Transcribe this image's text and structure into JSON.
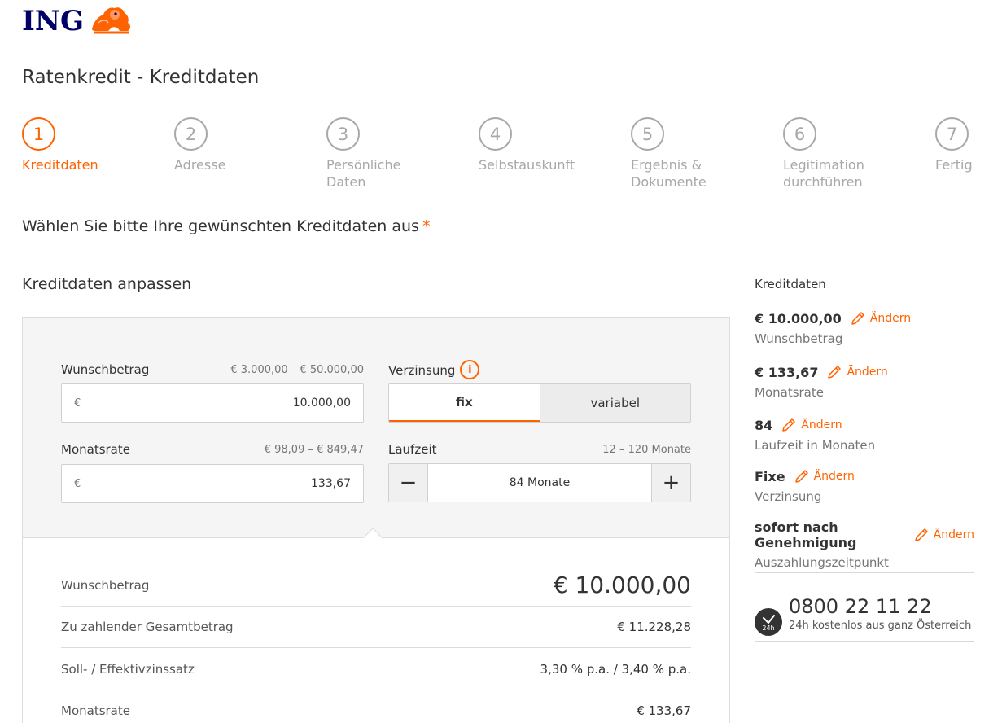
{
  "header": {
    "logo_text": "ING"
  },
  "page": {
    "title": "Ratenkredit - Kreditdaten"
  },
  "steps": [
    {
      "number": "1",
      "label": "Kreditdaten",
      "active": true
    },
    {
      "number": "2",
      "label": "Adresse",
      "active": false
    },
    {
      "number": "3",
      "label": "Persönliche\nDaten",
      "active": false
    },
    {
      "number": "4",
      "label": "Selbstauskunft",
      "active": false
    },
    {
      "number": "5",
      "label": "Ergebnis &\nDokumente",
      "active": false
    },
    {
      "number": "6",
      "label": "Legitimation\ndurchführen",
      "active": false
    },
    {
      "number": "7",
      "label": "Fertig",
      "active": false
    }
  ],
  "section": {
    "heading": "Wählen Sie bitte Ihre gewünschten Kreditdaten aus",
    "required_mark": "*"
  },
  "form": {
    "heading": "Kreditdaten anpassen",
    "wunschbetrag": {
      "label": "Wunschbetrag",
      "range": "€ 3.000,00 – € 50.000,00",
      "currency": "€",
      "value": "10.000,00"
    },
    "verzinsung": {
      "label": "Verzinsung",
      "info_glyph": "i",
      "options": [
        "fix",
        "variabel"
      ],
      "selected": "fix"
    },
    "monatsrate": {
      "label": "Monatsrate",
      "range": "€ 98,09 – € 849,47",
      "currency": "€",
      "value": "133,67"
    },
    "laufzeit": {
      "label": "Laufzeit",
      "range": "12 – 120 Monate",
      "value": "84 Monate",
      "minus": "−",
      "plus": "+"
    }
  },
  "summary": [
    {
      "label": "Wunschbetrag",
      "value": "€ 10.000,00"
    },
    {
      "label": "Zu zahlender Gesamtbetrag",
      "value": "€ 11.228,28"
    },
    {
      "label": "Soll- / Effektivzinssatz",
      "value": "3,30 % p.a. / 3,40 % p.a."
    },
    {
      "label": "Monatsrate",
      "value": "€ 133,67"
    }
  ],
  "sidebar": {
    "title": "Kreditdaten",
    "edit_label": "Ändern",
    "items": [
      {
        "value": "€ 10.000,00",
        "caption": "Wunschbetrag"
      },
      {
        "value": "€ 133,67",
        "caption": "Monatsrate"
      },
      {
        "value": "84",
        "caption": "Laufzeit in Monaten"
      },
      {
        "value": "Fixe",
        "caption": "Verzinsung"
      },
      {
        "value": "sofort nach Genehmigung",
        "caption": "Auszahlungszeitpunkt"
      }
    ],
    "phone": {
      "badge": "24h",
      "number": "0800 22 11 22",
      "subtitle": "24h kostenlos aus ganz Österreich"
    }
  },
  "colors": {
    "accent": "#ff6200",
    "brand_navy": "#000066",
    "muted": "#a8a8a8"
  }
}
